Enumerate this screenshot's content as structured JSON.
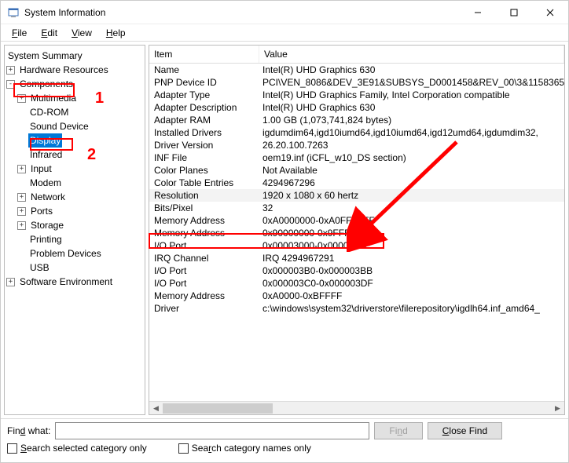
{
  "window": {
    "title": "System Information"
  },
  "menu": {
    "file": "File",
    "edit": "Edit",
    "view": "View",
    "help": "Help"
  },
  "tree": {
    "root": "System Summary",
    "hardware": "Hardware Resources",
    "components": "Components",
    "multimedia": "Multimedia",
    "cdrom": "CD-ROM",
    "sound": "Sound Device",
    "display": "Display",
    "infrared": "Infrared",
    "input": "Input",
    "modem": "Modem",
    "network": "Network",
    "ports": "Ports",
    "storage": "Storage",
    "printing": "Printing",
    "problem": "Problem Devices",
    "usb": "USB",
    "software_env": "Software Environment"
  },
  "headers": {
    "item": "Item",
    "value": "Value"
  },
  "rows": [
    {
      "item": "Name",
      "value": "Intel(R) UHD Graphics 630"
    },
    {
      "item": "PNP Device ID",
      "value": "PCI\\VEN_8086&DEV_3E91&SUBSYS_D0001458&REV_00\\3&1158365"
    },
    {
      "item": "Adapter Type",
      "value": "Intel(R) UHD Graphics Family, Intel Corporation compatible"
    },
    {
      "item": "Adapter Description",
      "value": "Intel(R) UHD Graphics 630"
    },
    {
      "item": "Adapter RAM",
      "value": "1.00 GB (1,073,741,824 bytes)"
    },
    {
      "item": "Installed Drivers",
      "value": "igdumdim64,igd10iumd64,igd10iumd64,igd12umd64,igdumdim32,"
    },
    {
      "item": "Driver Version",
      "value": "26.20.100.7263"
    },
    {
      "item": "INF File",
      "value": "oem19.inf (iCFL_w10_DS section)"
    },
    {
      "item": "Color Planes",
      "value": "Not Available"
    },
    {
      "item": "Color Table Entries",
      "value": "4294967296"
    },
    {
      "item": "Resolution",
      "value": "1920 x 1080 x 60 hertz",
      "highlight": true
    },
    {
      "item": "Bits/Pixel",
      "value": "32"
    },
    {
      "item": "Memory Address",
      "value": "0xA0000000-0xA0FFFFFF"
    },
    {
      "item": "Memory Address",
      "value": "0x90000000-0x9FFFFFFF"
    },
    {
      "item": "I/O Port",
      "value": "0x00003000-0x0000303F"
    },
    {
      "item": "IRQ Channel",
      "value": "IRQ 4294967291"
    },
    {
      "item": "I/O Port",
      "value": "0x000003B0-0x000003BB"
    },
    {
      "item": "I/O Port",
      "value": "0x000003C0-0x000003DF"
    },
    {
      "item": "Memory Address",
      "value": "0xA0000-0xBFFFF"
    },
    {
      "item": "Driver",
      "value": "c:\\windows\\system32\\driverstore\\filerepository\\igdlh64.inf_amd64_"
    }
  ],
  "search": {
    "label": "Find what:",
    "value": "",
    "find_btn": "Find",
    "close_btn": "Close Find",
    "cb1": "Search selected category only",
    "cb2": "Search category names only"
  },
  "annotations": {
    "num1": "1",
    "num2": "2"
  }
}
